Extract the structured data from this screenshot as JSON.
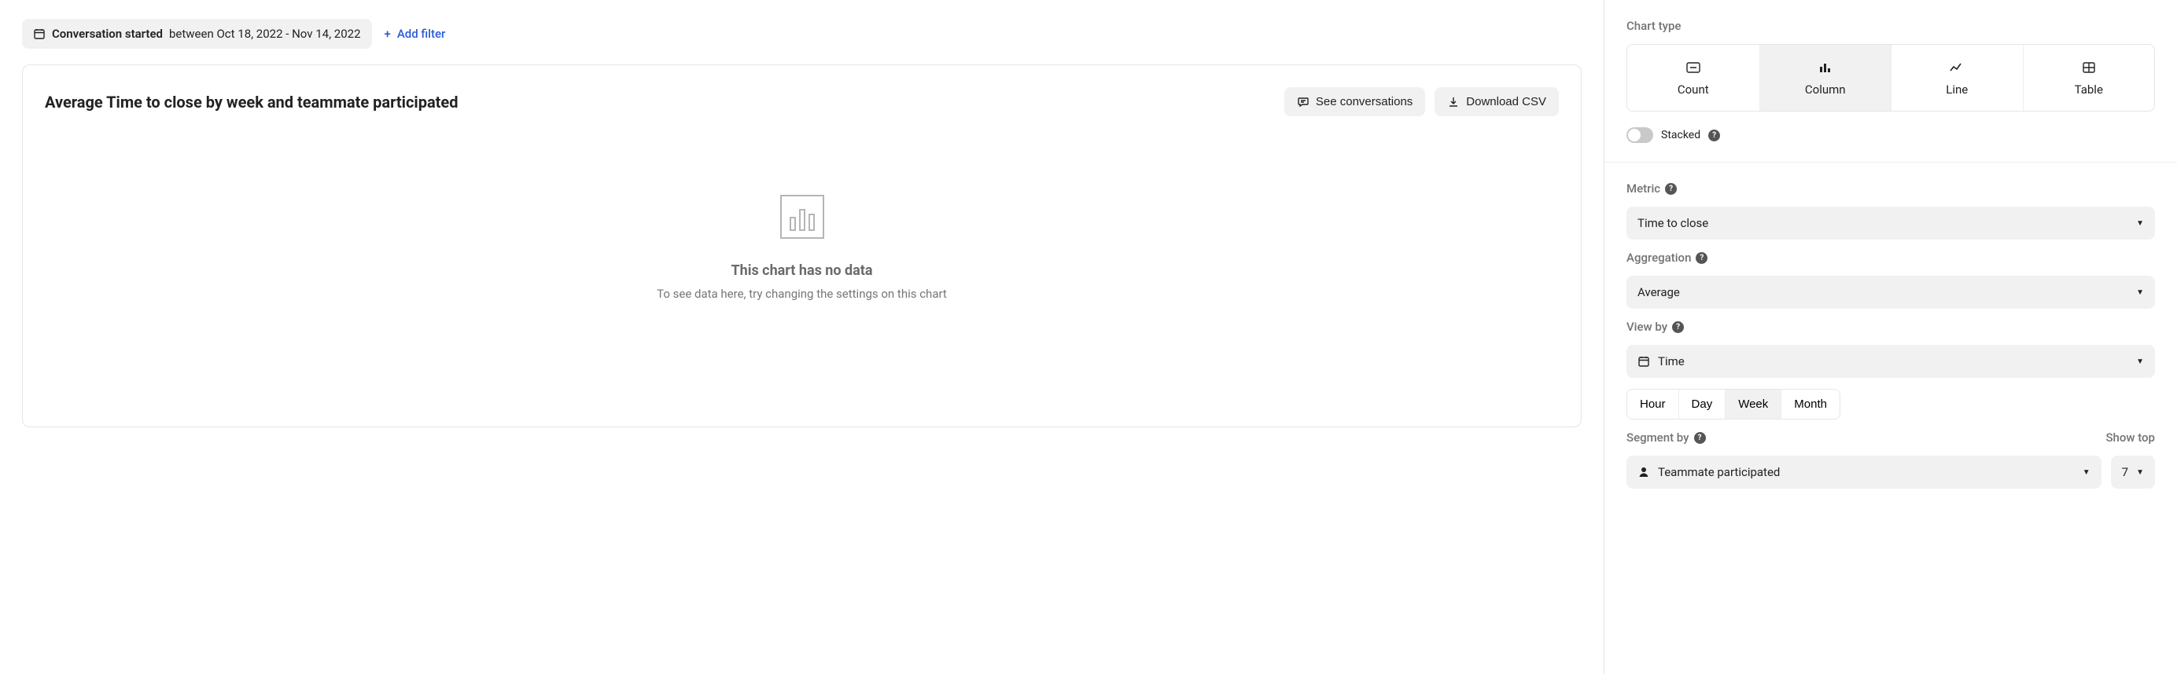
{
  "filters": {
    "date_pill_label": "Conversation started",
    "date_pill_range": "between Oct 18, 2022 - Nov 14, 2022",
    "add_filter_label": "Add filter"
  },
  "card": {
    "title": "Average Time to close by week and teammate participated",
    "see_conversations_label": "See conversations",
    "download_csv_label": "Download CSV",
    "empty_title": "This chart has no data",
    "empty_sub": "To see data here, try changing the settings on this chart"
  },
  "sidebar": {
    "chart_type_label": "Chart type",
    "chart_types": {
      "count": "Count",
      "column": "Column",
      "line": "Line",
      "table": "Table"
    },
    "stacked_label": "Stacked",
    "metric_label": "Metric",
    "metric_value": "Time to close",
    "aggregation_label": "Aggregation",
    "aggregation_value": "Average",
    "viewby_label": "View by",
    "viewby_value": "Time",
    "time_units": {
      "hour": "Hour",
      "day": "Day",
      "week": "Week",
      "month": "Month"
    },
    "segment_by_label": "Segment by",
    "segment_by_value": "Teammate participated",
    "show_top_label": "Show top",
    "show_top_value": "7"
  },
  "chart_data": {
    "type": "bar",
    "title": "Average Time to close by week and teammate participated",
    "categories": [],
    "series": [],
    "note": "no data"
  }
}
